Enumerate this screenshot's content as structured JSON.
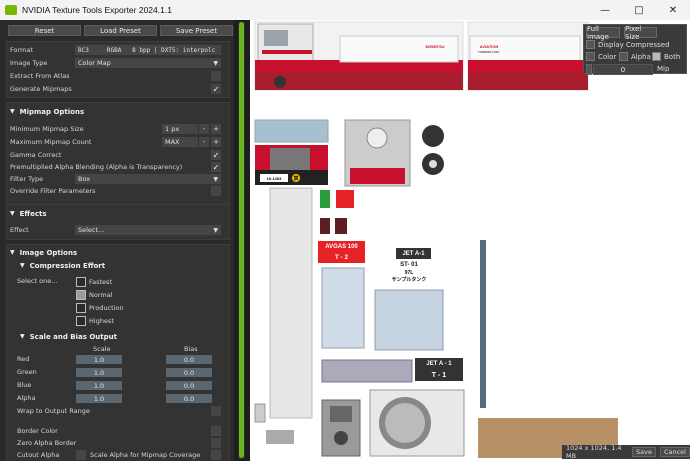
{
  "window": {
    "title": "NVIDIA Texture Tools Exporter 2024.1.1",
    "minimize": "—",
    "maximize": "□",
    "close": "✕"
  },
  "toolbar": {
    "reset": "Reset",
    "load_preset": "Load Preset",
    "save_preset": "Save Preset"
  },
  "format_section": {
    "format_label": "Format",
    "format_value": "BC3     RGBA   8 bpp | DXT5: interpolc",
    "image_type_label": "Image Type",
    "image_type_value": "Color Map",
    "extract_label": "Extract From Atlas",
    "extract_checked": false,
    "mipmaps_label": "Generate Mipmaps",
    "mipmaps_checked": true
  },
  "mipmap_options": {
    "header": "Mipmap Options",
    "min_size_label": "Minimum Mipmap Size",
    "min_size_value": "1 px",
    "max_count_label": "Maximum Mipmap Count",
    "max_count_value": "MAX",
    "gamma_label": "Gamma Correct",
    "gamma_checked": true,
    "premult_label": "Premultiplied Alpha Blending (Alpha is Transparency)",
    "premult_checked": true,
    "filter_label": "Filter Type",
    "filter_value": "Box",
    "override_label": "Override Filter Parameters",
    "override_checked": false,
    "minus": "-",
    "plus": "+"
  },
  "effects": {
    "header": "Effects",
    "effect_label": "Effect",
    "effect_value": "Select..."
  },
  "image_options": {
    "header": "Image Options",
    "compression_header": "Compression Effort",
    "select_one": "Select one...",
    "efforts": [
      "Fastest",
      "Normal",
      "Production",
      "Highest"
    ],
    "selected_effort": "Normal",
    "scale_bias_header": "Scale and Bias Output",
    "scale_col": "Scale",
    "bias_col": "Bias",
    "channels": [
      {
        "name": "Red",
        "scale": "1.0",
        "bias": "0.0"
      },
      {
        "name": "Green",
        "scale": "1.0",
        "bias": "0.0"
      },
      {
        "name": "Blue",
        "scale": "1.0",
        "bias": "0.0"
      },
      {
        "name": "Alpha",
        "scale": "1.0",
        "bias": "0.0"
      }
    ],
    "wrap_label": "Wrap to Output Range",
    "border_label": "Border Color",
    "zero_alpha_label": "Zero Alpha Border",
    "cutout_label": "Cutout Alpha",
    "scale_alpha_label": "Scale Alpha for Mipmap Coverage"
  },
  "viewer_controls": {
    "full_image": "Full Image",
    "pixel_size": "Pixel Size",
    "display_compressed": "Display Compressed",
    "color": "Color",
    "alpha": "Alpha",
    "both": "Both",
    "mip_value": "0",
    "mip_label": "Mip"
  },
  "status": {
    "info": "1024 x 1024, 1.4 MB",
    "save": "Save",
    "cancel": "Cancel"
  },
  "texture_labels": {
    "idemitsu": "IDEMITSU",
    "aviation": "AVIATION",
    "turbine_fuel": "TURBINE FUEL",
    "avgas": "AVGAS 100",
    "t2": "T - 2",
    "jet_a1_a": "JET A-1",
    "st01": "ST- 01",
    "st01_sub": "97L",
    "st01_jp": "サンプルタンク",
    "jet_a1_b": "JET  A - 1",
    "t1": "T - 1",
    "plate": "10-1403",
    "gas_kanji": "禁"
  },
  "colors": {
    "accent": "#76b900",
    "avgas_red": "#e52326",
    "truck_red": "#c8102e"
  }
}
